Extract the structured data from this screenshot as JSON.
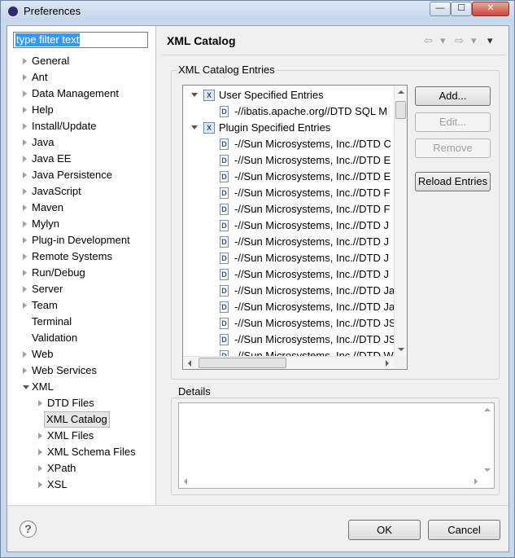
{
  "window": {
    "title": "Preferences",
    "min_glyph": "—",
    "max_glyph": "☐",
    "close_glyph": "✕"
  },
  "filter": {
    "placeholder": "type filter text"
  },
  "tree": [
    {
      "label": "General",
      "expander": "right",
      "indent": 0
    },
    {
      "label": "Ant",
      "expander": "right",
      "indent": 0
    },
    {
      "label": "Data Management",
      "expander": "right",
      "indent": 0
    },
    {
      "label": "Help",
      "expander": "right",
      "indent": 0
    },
    {
      "label": "Install/Update",
      "expander": "right",
      "indent": 0
    },
    {
      "label": "Java",
      "expander": "right",
      "indent": 0
    },
    {
      "label": "Java EE",
      "expander": "right",
      "indent": 0
    },
    {
      "label": "Java Persistence",
      "expander": "right",
      "indent": 0
    },
    {
      "label": "JavaScript",
      "expander": "right",
      "indent": 0
    },
    {
      "label": "Maven",
      "expander": "right",
      "indent": 0
    },
    {
      "label": "Mylyn",
      "expander": "right",
      "indent": 0
    },
    {
      "label": "Plug-in Development",
      "expander": "right",
      "indent": 0
    },
    {
      "label": "Remote Systems",
      "expander": "right",
      "indent": 0
    },
    {
      "label": "Run/Debug",
      "expander": "right",
      "indent": 0
    },
    {
      "label": "Server",
      "expander": "right",
      "indent": 0
    },
    {
      "label": "Team",
      "expander": "right",
      "indent": 0
    },
    {
      "label": "Terminal",
      "expander": "none",
      "indent": 0
    },
    {
      "label": "Validation",
      "expander": "none",
      "indent": 0
    },
    {
      "label": "Web",
      "expander": "right",
      "indent": 0
    },
    {
      "label": "Web Services",
      "expander": "right",
      "indent": 0
    },
    {
      "label": "XML",
      "expander": "down",
      "indent": 0
    },
    {
      "label": "DTD Files",
      "expander": "right",
      "indent": 1
    },
    {
      "label": "XML Catalog",
      "expander": "none",
      "indent": 1,
      "selected": true
    },
    {
      "label": "XML Files",
      "expander": "right",
      "indent": 1
    },
    {
      "label": "XML Schema Files",
      "expander": "right",
      "indent": 1
    },
    {
      "label": "XPath",
      "expander": "right",
      "indent": 1
    },
    {
      "label": "XSL",
      "expander": "right",
      "indent": 1
    }
  ],
  "page": {
    "title": "XML Catalog",
    "nav": {
      "back": "⇦",
      "back_menu": "▾",
      "forward": "⇨",
      "forward_menu": "▾",
      "view_menu": "▾"
    }
  },
  "catalog": {
    "group_label": "XML Catalog Entries",
    "entries": [
      {
        "type": "category",
        "label": "User Specified Entries"
      },
      {
        "type": "entry",
        "label": "-//ibatis.apache.org//DTD SQL M"
      },
      {
        "type": "category",
        "label": "Plugin Specified Entries"
      },
      {
        "type": "entry",
        "label": "-//Sun Microsystems, Inc.//DTD C"
      },
      {
        "type": "entry",
        "label": "-//Sun Microsystems, Inc.//DTD E"
      },
      {
        "type": "entry",
        "label": "-//Sun Microsystems, Inc.//DTD E"
      },
      {
        "type": "entry",
        "label": "-//Sun Microsystems, Inc.//DTD F"
      },
      {
        "type": "entry",
        "label": "-//Sun Microsystems, Inc.//DTD F"
      },
      {
        "type": "entry",
        "label": "-//Sun Microsystems, Inc.//DTD J"
      },
      {
        "type": "entry",
        "label": "-//Sun Microsystems, Inc.//DTD J"
      },
      {
        "type": "entry",
        "label": "-//Sun Microsystems, Inc.//DTD J"
      },
      {
        "type": "entry",
        "label": "-//Sun Microsystems, Inc.//DTD J"
      },
      {
        "type": "entry",
        "label": "-//Sun Microsystems, Inc.//DTD Ja"
      },
      {
        "type": "entry",
        "label": "-//Sun Microsystems, Inc.//DTD Ja"
      },
      {
        "type": "entry",
        "label": "-//Sun Microsystems, Inc.//DTD JS"
      },
      {
        "type": "entry",
        "label": "-//Sun Microsystems, Inc.//DTD JS"
      },
      {
        "type": "entry",
        "label": "-//Sun Microsystems, Inc.//DTD W"
      }
    ],
    "buttons": {
      "add": "Add...",
      "edit": "Edit...",
      "remove": "Remove",
      "reload": "Reload Entries"
    }
  },
  "details": {
    "group_label": "Details"
  },
  "footer": {
    "help_glyph": "?",
    "ok": "OK",
    "cancel": "Cancel"
  }
}
